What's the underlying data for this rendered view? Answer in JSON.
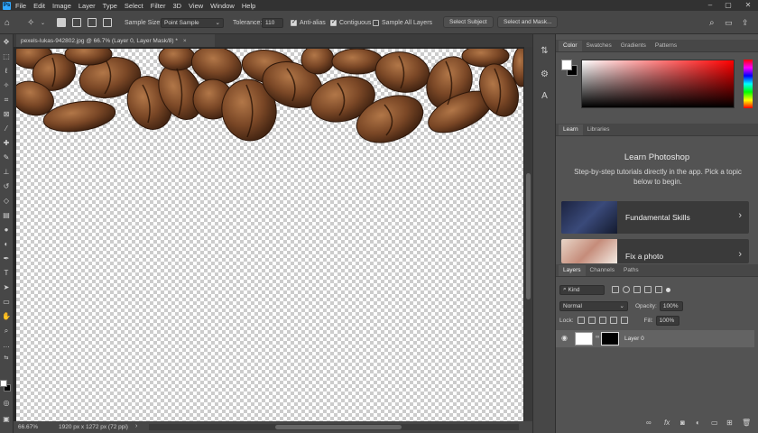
{
  "menubar": {
    "items": [
      "File",
      "Edit",
      "Image",
      "Layer",
      "Type",
      "Select",
      "Filter",
      "3D",
      "View",
      "Window",
      "Help"
    ]
  },
  "options": {
    "sample_size_label": "Sample Size:",
    "sample_size_value": "Point Sample",
    "tolerance_label": "Tolerance:",
    "tolerance_value": "110",
    "anti_alias_label": "Anti-alias",
    "contiguous_label": "Contiguous",
    "sample_all_layers_label": "Sample All Layers",
    "select_subject_label": "Select Subject",
    "select_and_mask_label": "Select and Mask..."
  },
  "document": {
    "tab_title": "pexels-lukas-942802.jpg @ 66.7% (Layer 0, Layer Mask/8) *"
  },
  "status": {
    "zoom": "66.67%",
    "dimensions": "1920 px x 1272 px (72 ppi)"
  },
  "color_panel": {
    "tabs": [
      "Color",
      "Swatches",
      "Gradients",
      "Patterns"
    ],
    "foreground": "#ffffff",
    "background": "#000000"
  },
  "learn_panel": {
    "tabs": [
      "Learn",
      "Libraries"
    ],
    "title": "Learn Photoshop",
    "description": "Step-by-step tutorials directly in the app. Pick a topic below to begin.",
    "cards": [
      {
        "label": "Fundamental Skills"
      },
      {
        "label": "Fix a photo"
      }
    ]
  },
  "layers_panel": {
    "tabs": [
      "Layers",
      "Channels",
      "Paths"
    ],
    "filter_kind": "Kind",
    "blend_mode": "Normal",
    "opacity_label": "Opacity:",
    "opacity_value": "100%",
    "lock_label": "Lock:",
    "fill_label": "Fill:",
    "fill_value": "100%",
    "layers": [
      {
        "name": "Layer 0"
      }
    ]
  }
}
